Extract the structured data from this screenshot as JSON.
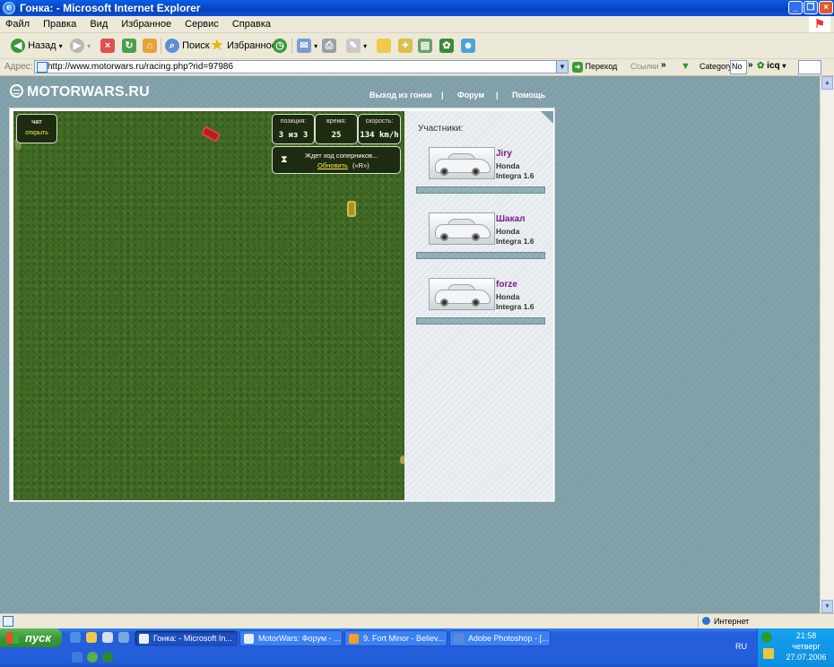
{
  "window": {
    "title": "Гонка: - Microsoft Internet Explorer"
  },
  "menu": [
    "Файл",
    "Правка",
    "Вид",
    "Избранное",
    "Сервис",
    "Справка"
  ],
  "toolbar": {
    "back": "Назад",
    "search": "Поиск",
    "favorites": "Избранное"
  },
  "address": {
    "label": "Адрес:",
    "url": "http://www.motorwars.ru/racing.php?rid=97986",
    "go": "Переход",
    "links": "Ссылки",
    "category_label": "Category",
    "category_value": "No",
    "icq": "icq"
  },
  "site": {
    "logo": "MOTORWARS.RU",
    "nav": [
      "Выход из гонки",
      "Форум",
      "Помощь"
    ],
    "nav_sep": "|"
  },
  "game": {
    "chat": {
      "label": "чат",
      "open": "открыть"
    },
    "position": {
      "label": "позиция:",
      "value": "3 из 3"
    },
    "time": {
      "label": "время:",
      "value": "25"
    },
    "speed": {
      "label": "скорость:",
      "value": "134 km/h"
    },
    "waiting": {
      "message": "Ждет ход соперников...",
      "refresh": "Обновить",
      "key": "(«R»)"
    }
  },
  "participants": {
    "title": "Участники:",
    "list": [
      {
        "name": "Jiry",
        "car_make": "Honda",
        "car_model": "Integra 1.6"
      },
      {
        "name": "Шакал",
        "car_make": "Honda",
        "car_model": "Integra 1.6"
      },
      {
        "name": "forze",
        "car_make": "Honda",
        "car_model": "Integra 1.6"
      }
    ]
  },
  "statusbar": {
    "zone": "Интернет"
  },
  "taskbar": {
    "start": "пуск",
    "tasks": [
      "Гонка: - Microsoft In...",
      "MotorWars: Форум - ...",
      "9. Fort Minor - Believ...",
      "Adobe Photoshop - [..."
    ],
    "lang": "RU",
    "time": "21:58",
    "day": "четверг",
    "date": "27.07.2006"
  },
  "colors": {
    "page_bg": "#7f9ea7",
    "grass": "#3f6b21",
    "player_name": "#7a1c8a",
    "hud_link": "#ffe94b"
  }
}
